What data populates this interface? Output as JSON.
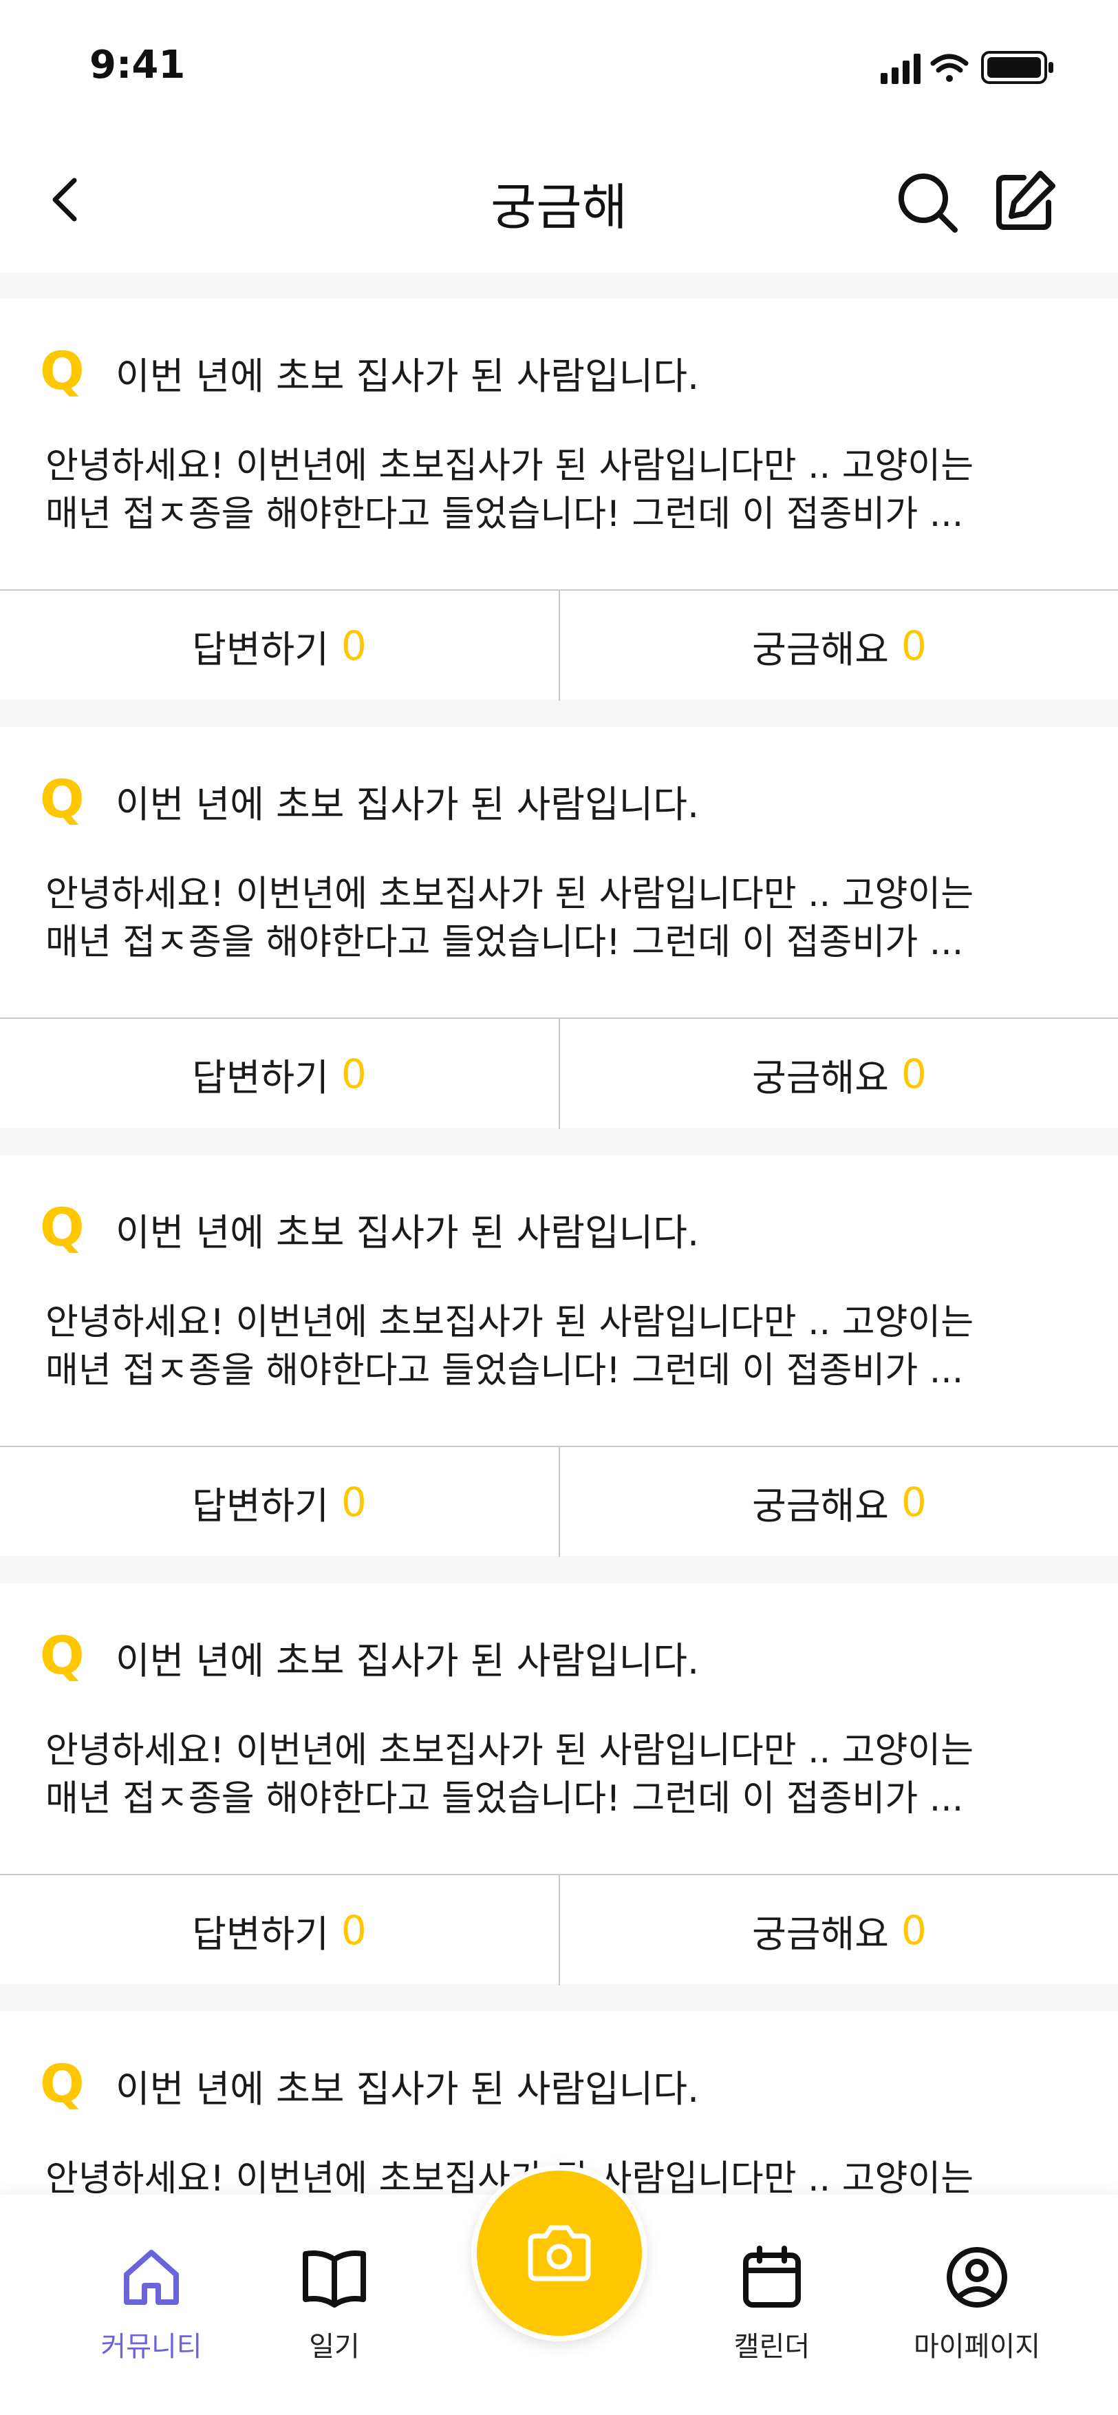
{
  "status_bar": {
    "time": "9:41"
  },
  "header": {
    "title": "궁금해"
  },
  "posts": [
    {
      "q_mark": "Q",
      "title": "이번 년에 초보 집사가 된 사람입니다.",
      "body_line1": "안녕하세요! 이번년에 초보집사가 된 사람입니다만 .. 고양이는",
      "body_line2": "매년 접ㅈ종을 해야한다고 들었습니다! 그런데 이 접종비가 ...",
      "answer_label": "답변하기",
      "answer_count": "0",
      "curious_label": "궁금해요",
      "curious_count": "0"
    },
    {
      "q_mark": "Q",
      "title": "이번 년에 초보 집사가 된 사람입니다.",
      "body_line1": "안녕하세요! 이번년에 초보집사가 된 사람입니다만 .. 고양이는",
      "body_line2": "매년 접ㅈ종을 해야한다고 들었습니다! 그런데 이 접종비가 ...",
      "answer_label": "답변하기",
      "answer_count": "0",
      "curious_label": "궁금해요",
      "curious_count": "0"
    },
    {
      "q_mark": "Q",
      "title": "이번 년에 초보 집사가 된 사람입니다.",
      "body_line1": "안녕하세요! 이번년에 초보집사가 된 사람입니다만 .. 고양이는",
      "body_line2": "매년 접ㅈ종을 해야한다고 들었습니다! 그런데 이 접종비가 ...",
      "answer_label": "답변하기",
      "answer_count": "0",
      "curious_label": "궁금해요",
      "curious_count": "0"
    },
    {
      "q_mark": "Q",
      "title": "이번 년에 초보 집사가 된 사람입니다.",
      "body_line1": "안녕하세요! 이번년에 초보집사가 된 사람입니다만 .. 고양이는",
      "body_line2": "매년 접ㅈ종을 해야한다고 들었습니다! 그런데 이 접종비가 ...",
      "answer_label": "답변하기",
      "answer_count": "0",
      "curious_label": "궁금해요",
      "curious_count": "0"
    },
    {
      "q_mark": "Q",
      "title": "이번 년에 초보 집사가 된 사람입니다.",
      "body_line1": "안녕하세요! 이번년에 초보집사가 된 사람입니다만 .. 고양이는"
    }
  ],
  "tab_bar": {
    "tabs": [
      {
        "label": "커뮤니티",
        "icon": "home-icon",
        "active": true
      },
      {
        "label": "일기",
        "icon": "book-icon"
      },
      {
        "label": "캘린더",
        "icon": "calendar-icon"
      },
      {
        "label": "마이페이지",
        "icon": "user-circle-icon"
      }
    ],
    "camera_icon": "camera-icon"
  },
  "colors": {
    "accent": "#ffc700",
    "active_tab": "#6b63d9",
    "text": "#1a1a1a",
    "divider": "#c9c9c9",
    "background": "#f7f7f7"
  }
}
